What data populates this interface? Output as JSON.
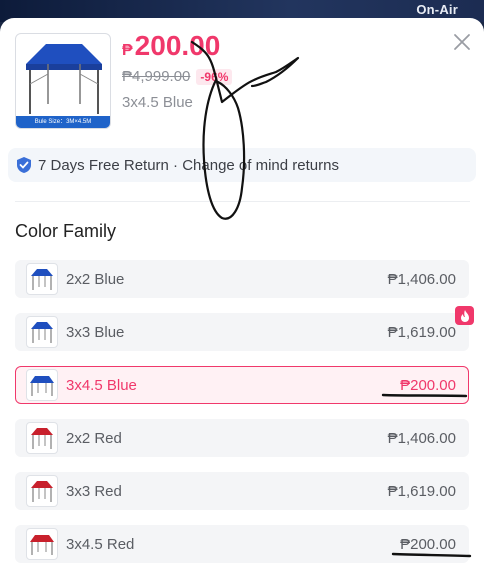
{
  "background": {
    "badge": "On-Air"
  },
  "product": {
    "currency": "₱",
    "price": "200.00",
    "original_price": "₱4,999.00",
    "discount": "-96%",
    "selected_variant": "3x4.5 Blue",
    "thumbnail_caption": "Bule  Size：3M×4.5M"
  },
  "return_policy": {
    "text": "7 Days Free Return · Change of mind returns"
  },
  "color_family": {
    "title": "Color Family",
    "options": [
      {
        "label": "2x2 Blue",
        "price": "₱1,406.00",
        "color": "#1f4fbf"
      },
      {
        "label": "3x3 Blue",
        "price": "₱1,619.00",
        "color": "#1f4fbf"
      },
      {
        "label": "3x4.5 Blue",
        "price": "₱200.00",
        "color": "#1f4fbf"
      },
      {
        "label": "2x2 Red",
        "price": "₱1,406.00",
        "color": "#c8202c"
      },
      {
        "label": "3x3 Red",
        "price": "₱1,619.00",
        "color": "#c8202c"
      },
      {
        "label": "3x4.5 Red",
        "price": "₱200.00",
        "color": "#c8202c"
      }
    ]
  },
  "colors": {
    "accent": "#f0386b",
    "blue_canopy": "#1f4fbf",
    "red_canopy": "#c8202c"
  }
}
